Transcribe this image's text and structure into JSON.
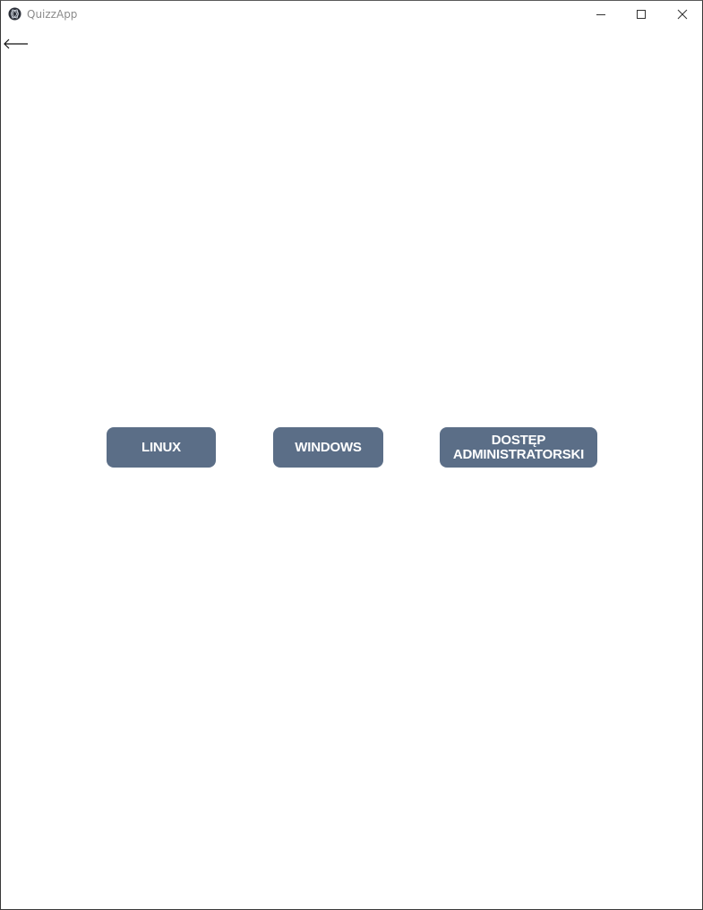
{
  "window": {
    "title": "QuizzApp"
  },
  "icons": {
    "app": "app-logo-icon",
    "minimize": "minimize-icon",
    "maximize": "maximize-icon",
    "close": "close-icon",
    "back": "back-arrow-icon"
  },
  "colors": {
    "button_bg": "#5b6e87",
    "button_text": "#ffffff",
    "title_text": "#8c8c8c"
  },
  "main": {
    "buttons": [
      {
        "label": "LINUX"
      },
      {
        "label": "WINDOWS"
      },
      {
        "label": "DOSTĘP\nADMINISTRATORSKI"
      }
    ]
  }
}
